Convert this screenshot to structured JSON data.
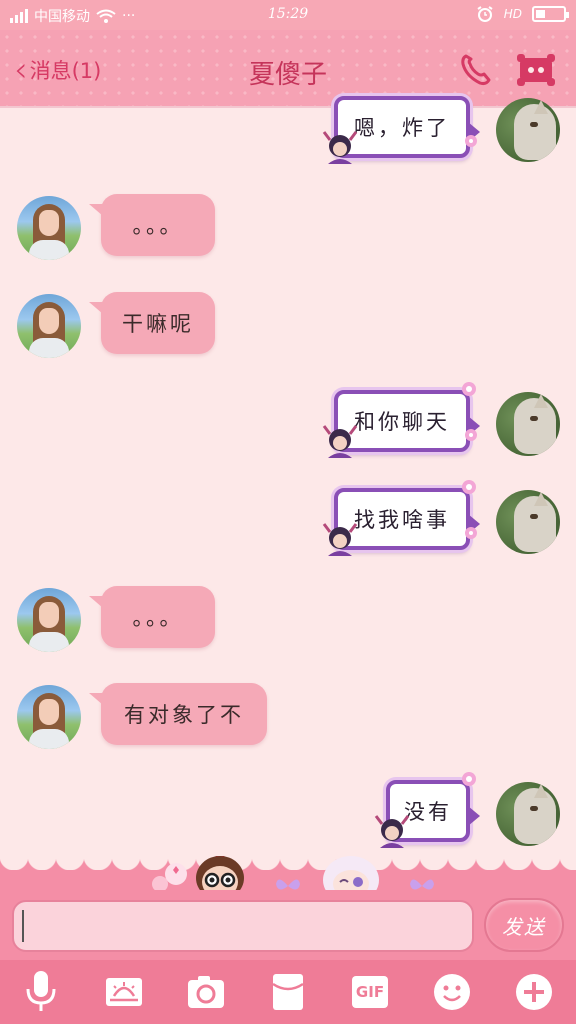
{
  "status_bar": {
    "carrier": "中国移动",
    "wifi_dots": "···",
    "time": "15:29",
    "network": "HD"
  },
  "header": {
    "back_label": "消息(1)",
    "title": "夏傻子"
  },
  "messages": [
    {
      "side": "out",
      "text": "嗯，炸了"
    },
    {
      "side": "in",
      "text": "。。。"
    },
    {
      "side": "in",
      "text": "干嘛呢"
    },
    {
      "side": "out",
      "text": "和你聊天"
    },
    {
      "side": "out",
      "text": "找我啥事"
    },
    {
      "side": "in",
      "text": "。。。"
    },
    {
      "side": "in",
      "text": "有对象了不"
    },
    {
      "side": "out",
      "text": "没有"
    }
  ],
  "input": {
    "value": "",
    "send_label": "发送"
  },
  "toolbar": {
    "gif_label": "GIF",
    "icons": [
      "microphone-icon",
      "image-icon",
      "camera-icon",
      "red-packet-icon",
      "gif-icon",
      "emoji-icon",
      "plus-icon"
    ]
  },
  "colors": {
    "header_bg": "#f6a2b4",
    "chat_bg": "#fde8e8",
    "bubble_in": "#f5a9b7",
    "bubble_out_border": "#8a4fb6",
    "accent": "#d63a64",
    "toolbar_bg": "#ef7c97"
  }
}
